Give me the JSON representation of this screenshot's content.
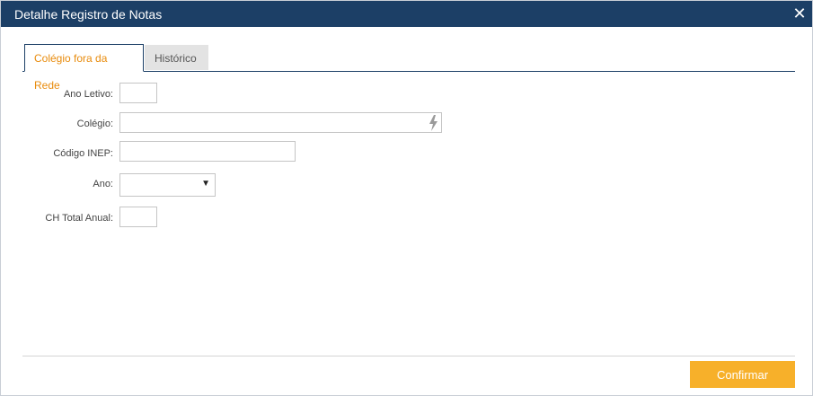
{
  "dialog": {
    "title": "Detalhe Registro de Notas",
    "close_icon": "close-icon"
  },
  "tabs": [
    {
      "label": "Colégio fora da Rede",
      "active": true
    },
    {
      "label": "Histórico",
      "active": false
    }
  ],
  "form": {
    "ano_letivo": {
      "label": "Ano Letivo:",
      "value": ""
    },
    "colegio": {
      "label": "Colégio:",
      "value": "",
      "icon": "lightning-bolt-icon"
    },
    "codigo_inep": {
      "label": "Código INEP:",
      "value": ""
    },
    "ano": {
      "label": "Ano:",
      "value": "",
      "icon": "dropdown-arrow-icon"
    },
    "ch_total_anual": {
      "label": "CH Total Anual:",
      "value": ""
    }
  },
  "footer": {
    "confirm_label": "Confirmar"
  },
  "colors": {
    "titlebar": "#1c3f66",
    "accent": "#e88b0c",
    "confirm_button": "#f7b02a"
  }
}
